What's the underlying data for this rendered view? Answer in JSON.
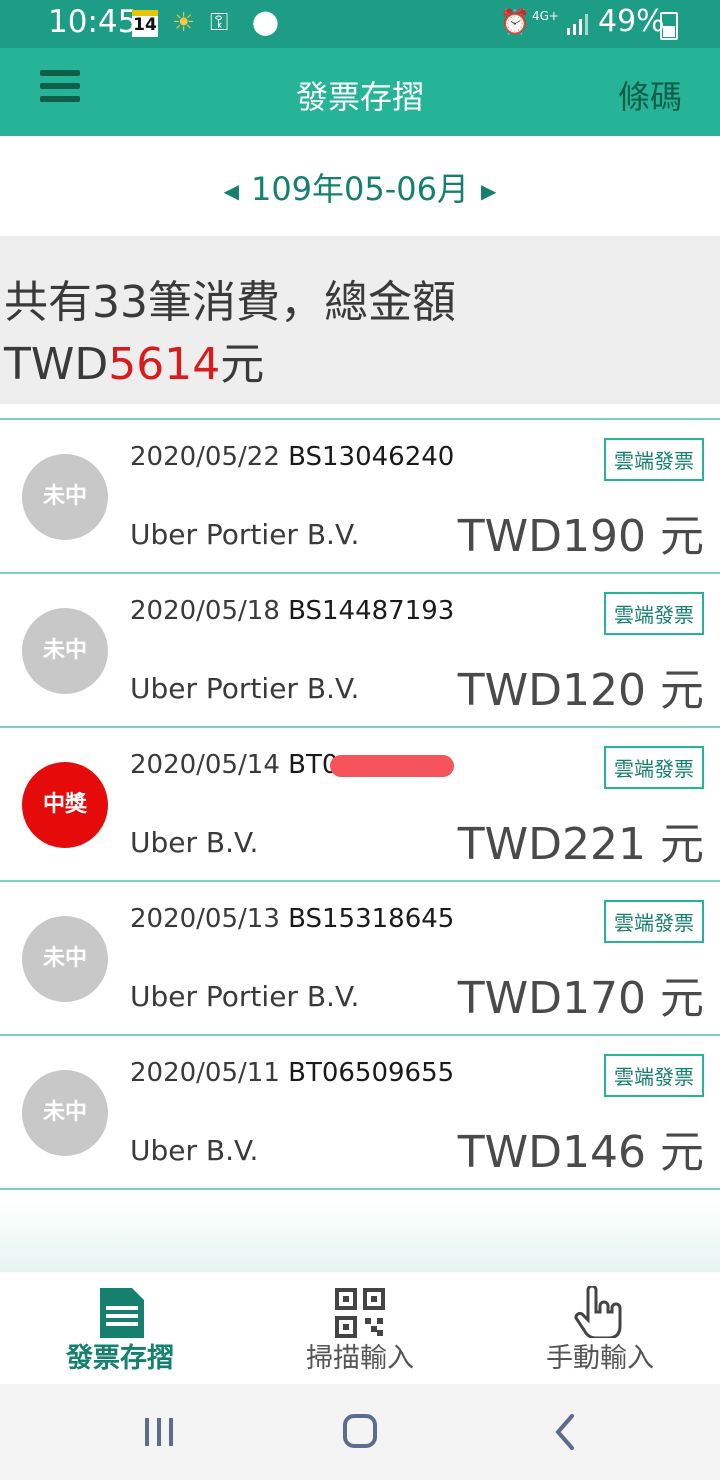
{
  "status_bar": {
    "time": "10:45",
    "calendar_day": "14",
    "network": "4G+",
    "battery": "49%"
  },
  "app_bar": {
    "title": "發票存摺",
    "barcode_label": "條碼"
  },
  "period": {
    "label": "109年05-06月"
  },
  "summary": {
    "line1": "共有33筆消費，總金額",
    "currency": "TWD",
    "amount": "5614",
    "unit": "元"
  },
  "invoices": [
    {
      "status": "未中",
      "win": false,
      "date": "2020/05/22",
      "number": "BS13046240",
      "seller": "Uber Portier B.V.",
      "tag": "雲端發票",
      "price": "TWD190 元"
    },
    {
      "status": "未中",
      "win": false,
      "date": "2020/05/18",
      "number": "BS14487193",
      "seller": "Uber Portier B.V.",
      "tag": "雲端發票",
      "price": "TWD120 元"
    },
    {
      "status": "中獎",
      "win": true,
      "date": "2020/05/14",
      "number": "BT0",
      "seller": "Uber B.V.",
      "tag": "雲端發票",
      "price": "TWD221 元"
    },
    {
      "status": "未中",
      "win": false,
      "date": "2020/05/13",
      "number": "BS15318645",
      "seller": "Uber Portier B.V.",
      "tag": "雲端發票",
      "price": "TWD170 元"
    },
    {
      "status": "未中",
      "win": false,
      "date": "2020/05/11",
      "number": "BT06509655",
      "seller": "Uber B.V.",
      "tag": "雲端發票",
      "price": "TWD146 元"
    }
  ],
  "bottom_nav": {
    "tabs": [
      {
        "label": "發票存摺",
        "icon": "document-icon"
      },
      {
        "label": "掃描輸入",
        "icon": "qr-code-icon"
      },
      {
        "label": "手動輸入",
        "icon": "hand-pointer-icon"
      }
    ]
  },
  "colors": {
    "status_bar": "#1d9c86",
    "app_bar": "#26b498",
    "accent_dark": "#0e5e48",
    "amount_red": "#d81b1b",
    "win_badge": "#e60b0b",
    "lose_badge": "#c8c8c8"
  }
}
